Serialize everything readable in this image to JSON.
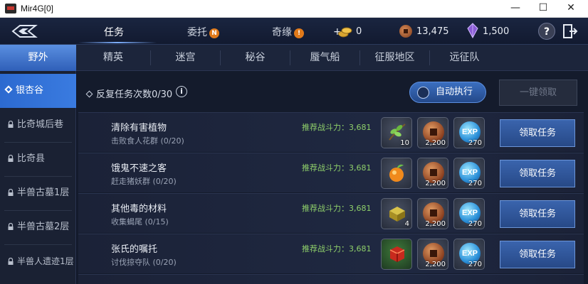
{
  "window": {
    "title": "Mir4G[0]",
    "min": "—",
    "max": "☐",
    "close": "✕"
  },
  "topbar": {
    "tabs": [
      {
        "label": "任务"
      },
      {
        "label": "委托",
        "badge": "N"
      },
      {
        "label": "奇缘",
        "badge": "!"
      }
    ],
    "resources": {
      "gold_prefix": "+",
      "gold": "0",
      "copper": "13,475",
      "crystal": "1,500"
    },
    "help": "?"
  },
  "categories": [
    "野外",
    "精英",
    "迷宫",
    "秘谷",
    "蜃气船",
    "征服地区",
    "远征队"
  ],
  "sidebar": [
    "银杏谷",
    "比奇城后巷",
    "比奇县",
    "半兽古墓1层",
    "半兽古墓2层",
    "半兽人遗迹1层"
  ],
  "main": {
    "repeat_label": "反复任务次数0/30",
    "info": "i",
    "auto_label": "自动执行",
    "claim_all_label": "一键领取",
    "quests": [
      {
        "name": "清除有害植物",
        "sub": "击败食人花群 (0/20)",
        "power": "推荐战斗力：3,681",
        "item_count": "10",
        "copper": "2,200",
        "exp": "270",
        "claim": "领取任务"
      },
      {
        "name": "饿鬼不速之客",
        "sub": "赶走猪妖群 (0/20)",
        "power": "推荐战斗力：3,681",
        "item_count": "",
        "copper": "2,200",
        "exp": "270",
        "claim": "领取任务"
      },
      {
        "name": "其他毒的材料",
        "sub": "收集蝎尾 (0/15)",
        "power": "推荐战斗力：3,681",
        "item_count": "4",
        "copper": "2,200",
        "exp": "270",
        "claim": "领取任务"
      },
      {
        "name": "张氏的嘱托",
        "sub": "讨伐掠夺队 (0/20)",
        "power": "推荐战斗力：3,681",
        "item_count": "",
        "copper": "2,200",
        "exp": "270",
        "claim": "领取任务"
      }
    ],
    "exp_text": "EXP"
  },
  "colors": {
    "accent": "#3a7be0",
    "power_green": "#8fd06a",
    "badge_orange": "#e17a1a"
  }
}
